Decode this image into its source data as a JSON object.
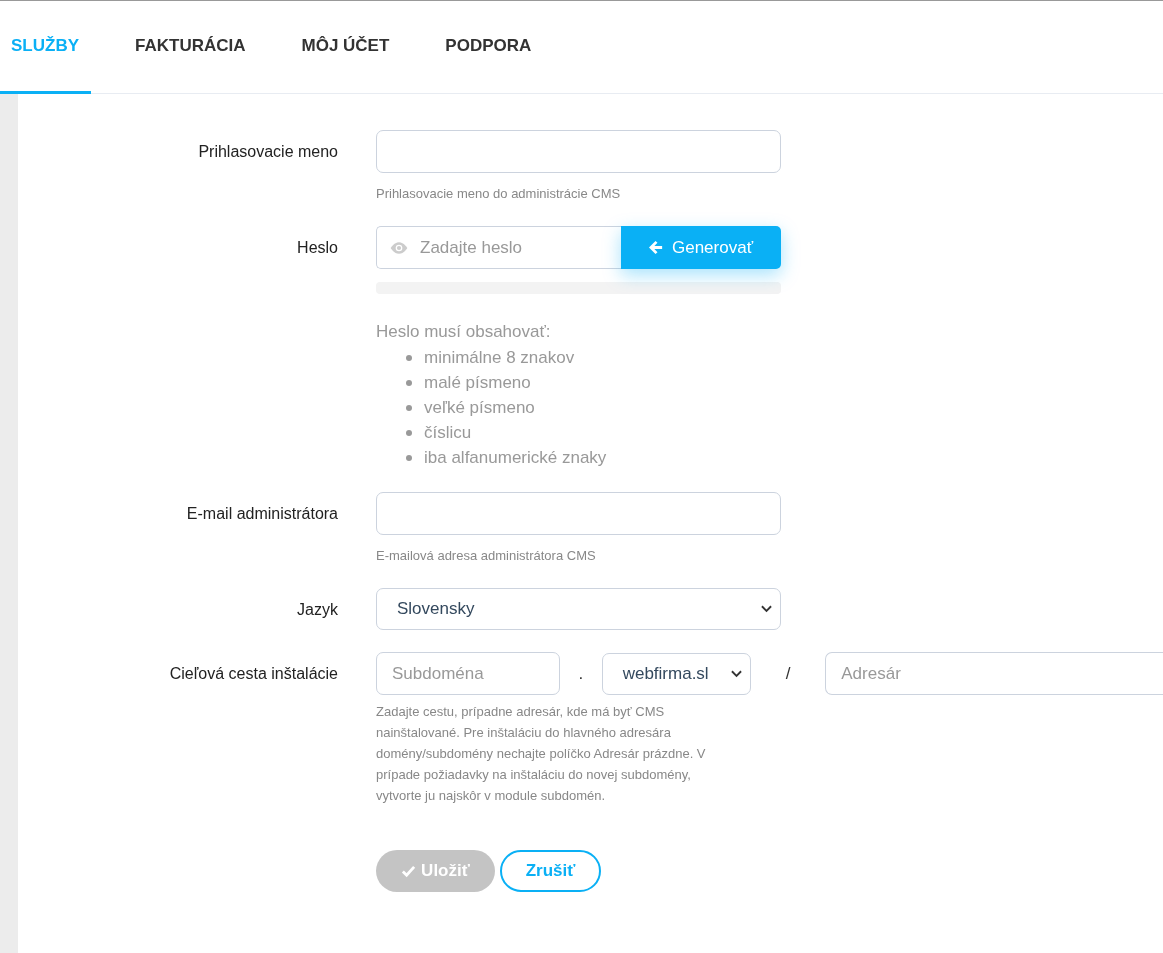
{
  "tabs": [
    {
      "label": "SLUŽBY",
      "selected": true
    },
    {
      "label": "FAKTURÁCIA",
      "selected": false
    },
    {
      "label": "MÔJ ÚČET",
      "selected": false
    },
    {
      "label": "PODPORA",
      "selected": false
    }
  ],
  "form": {
    "username": {
      "label": "Prihlasovacie meno",
      "help": "Prihlasovacie meno do administrácie CMS"
    },
    "password": {
      "label": "Heslo",
      "placeholder": "Zadajte heslo",
      "generate": "Generovať",
      "strength": {
        "level": 0
      },
      "rules_title": "Heslo musí obsahovať:",
      "rules": [
        "minimálne 8 znakov",
        "malé písmeno",
        "veľké písmeno",
        "číslicu",
        "iba alfanumerické znaky"
      ]
    },
    "email": {
      "label": "E-mail administrátora",
      "help": "E-mailová adresa administrátora CMS"
    },
    "language": {
      "label": "Jazyk",
      "value": "Slovensky"
    },
    "path": {
      "label": "Cieľová cesta inštalácie",
      "subdomain_placeholder": "Subdoména",
      "dot": ".",
      "domain": "webfirma.sl",
      "slash": "/",
      "directory_placeholder": "Adresár",
      "help": "Zadajte cestu, prípadne adresár, kde má byť CMS nainštalované. Pre inštaláciu do hlavného adresára domény/subdomény nechajte políčko Adresár prázdne. V prípade požiadavky na inštaláciu do novej subdomény, vytvorte ju najskôr v module subdomén."
    }
  },
  "buttons": {
    "save": {
      "label": "Uložiť",
      "disabled": true
    },
    "cancel": {
      "label": "Zrušiť"
    }
  }
}
